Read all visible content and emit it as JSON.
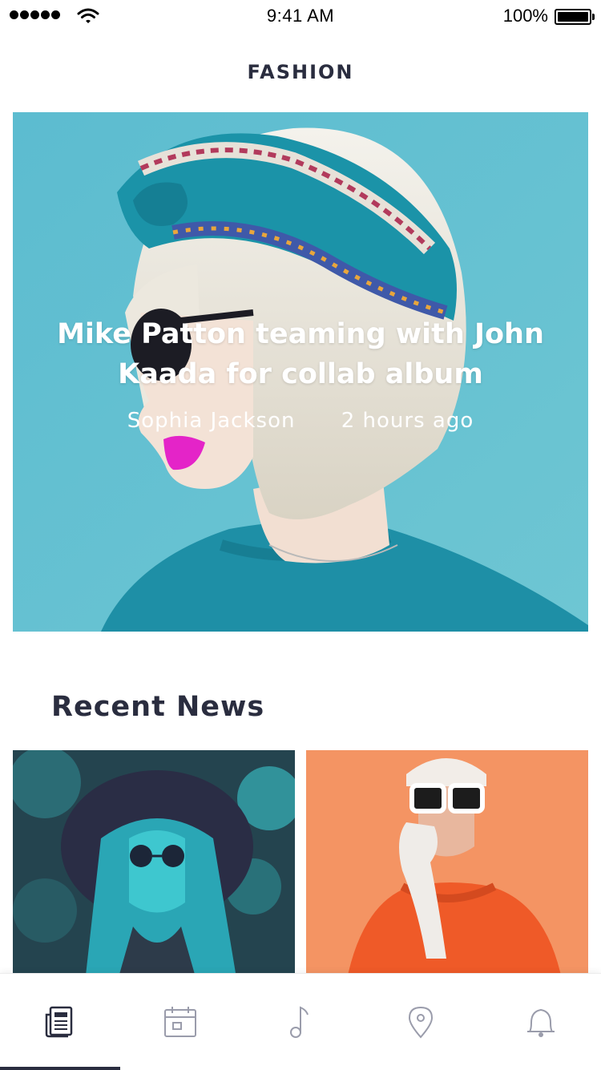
{
  "status_bar": {
    "time": "9:41 AM",
    "battery_percent": "100%",
    "signal_icon": "signal-dots-icon",
    "wifi_icon": "wifi-icon",
    "battery_icon": "battery-icon"
  },
  "header": {
    "title": "FASHION"
  },
  "featured": {
    "title": "Mike Patton teaming with John Kaada for collab album",
    "author": "Sophia Jackson",
    "time_ago": "2 hours ago",
    "background_color": "#62bfd0"
  },
  "recent": {
    "title": "Recent News",
    "cards": [
      {
        "image": "woman-in-hat-sunglasses-teal",
        "color": "#2a4a55"
      },
      {
        "image": "woman-white-sunglasses-orange-coat",
        "color": "#f49463"
      }
    ]
  },
  "tab_bar": {
    "active_index": 0,
    "tabs": [
      {
        "icon": "newspaper-icon"
      },
      {
        "icon": "calendar-icon"
      },
      {
        "icon": "music-note-icon"
      },
      {
        "icon": "location-pin-icon"
      },
      {
        "icon": "bell-icon"
      }
    ]
  }
}
